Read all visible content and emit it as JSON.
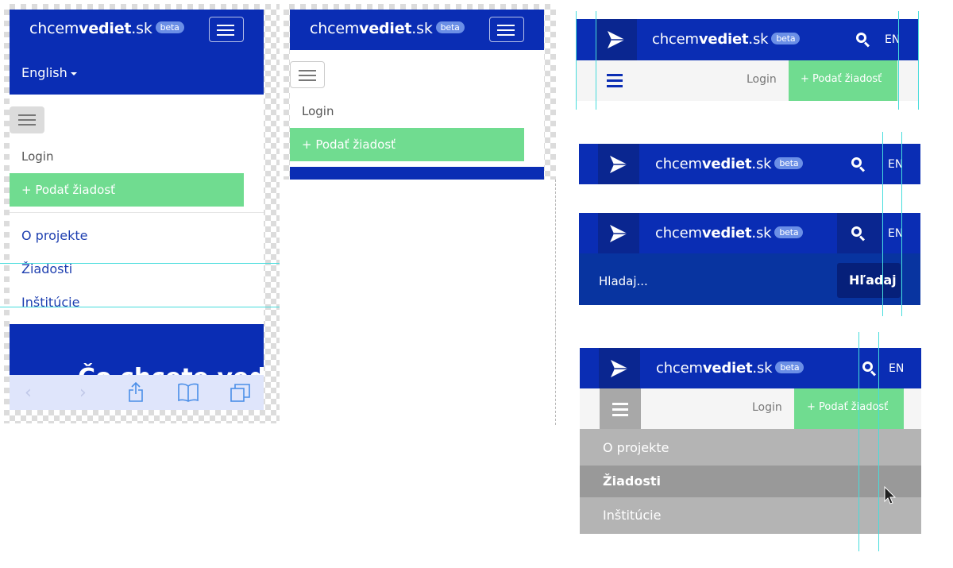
{
  "brand": {
    "name_light": "chcem",
    "name_bold": "vediet",
    "name_tld": ".sk",
    "beta": "beta"
  },
  "mobile1": {
    "language": "English",
    "nav_login": "Login",
    "nav_cta": "+ Podať žiadosť",
    "menu": [
      "O projekte",
      "Žiadosti",
      "Inštitúcie"
    ],
    "partial_heading": "Čo chcete vedieť?"
  },
  "mobile2": {
    "nav_login": "Login",
    "nav_cta": "+ Podať žiadosť"
  },
  "desktop": {
    "lang": "EN",
    "login": "Login",
    "cta": "+ Podať žiadosť",
    "search_placeholder": "Hladaj...",
    "search_button": "Hľadaj",
    "menu": [
      "O projekte",
      "Žiadosti",
      "Inštitúcie"
    ]
  },
  "colors": {
    "brand_blue": "#0a2db4",
    "green": "#70dc90",
    "guide": "#46dcdc"
  }
}
